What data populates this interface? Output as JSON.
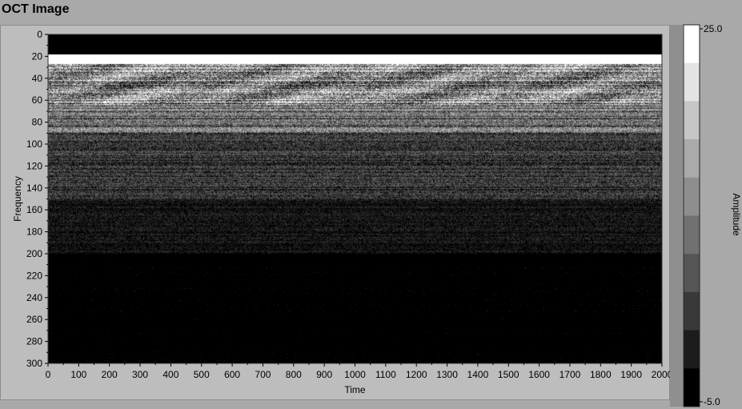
{
  "panel": {
    "title": "OCT Image"
  },
  "graph": {
    "x_axis_title": "Time",
    "y_axis_title": "Frequency",
    "x_ticks": [
      "0",
      "100",
      "200",
      "300",
      "400",
      "500",
      "600",
      "700",
      "800",
      "900",
      "1000",
      "1100",
      "1200",
      "1300",
      "1400",
      "1500",
      "1600",
      "1700",
      "1800",
      "1900",
      "2000"
    ],
    "y_ticks": [
      "0",
      "20",
      "40",
      "60",
      "80",
      "100",
      "120",
      "140",
      "160",
      "180",
      "200",
      "220",
      "240",
      "260",
      "280",
      "300"
    ],
    "x_range": [
      0,
      2000
    ],
    "y_range": [
      0,
      300
    ]
  },
  "colorbar": {
    "title": "Amplitude",
    "max_label": "25.0",
    "min_label": "-5.0",
    "range": [
      -5.0,
      25.0
    ],
    "levels": 10
  },
  "image_profile": {
    "description_rows": [
      {
        "from": 0,
        "to": 18,
        "level": 0.02
      },
      {
        "from": 18,
        "to": 27,
        "level": 1.0
      },
      {
        "from": 27,
        "to": 64,
        "level": 0.55,
        "speckle": 0.35
      },
      {
        "from": 64,
        "to": 90,
        "level": 0.42,
        "speckle": 0.25
      },
      {
        "from": 90,
        "to": 150,
        "level": 0.22,
        "speckle": 0.18
      },
      {
        "from": 150,
        "to": 200,
        "level": 0.08,
        "speckle": 0.1
      },
      {
        "from": 200,
        "to": 300,
        "level": 0.02,
        "speckle": 0.03
      }
    ]
  },
  "colors": {
    "background": "#a9a9a9",
    "frame": "#bdbdbd"
  }
}
